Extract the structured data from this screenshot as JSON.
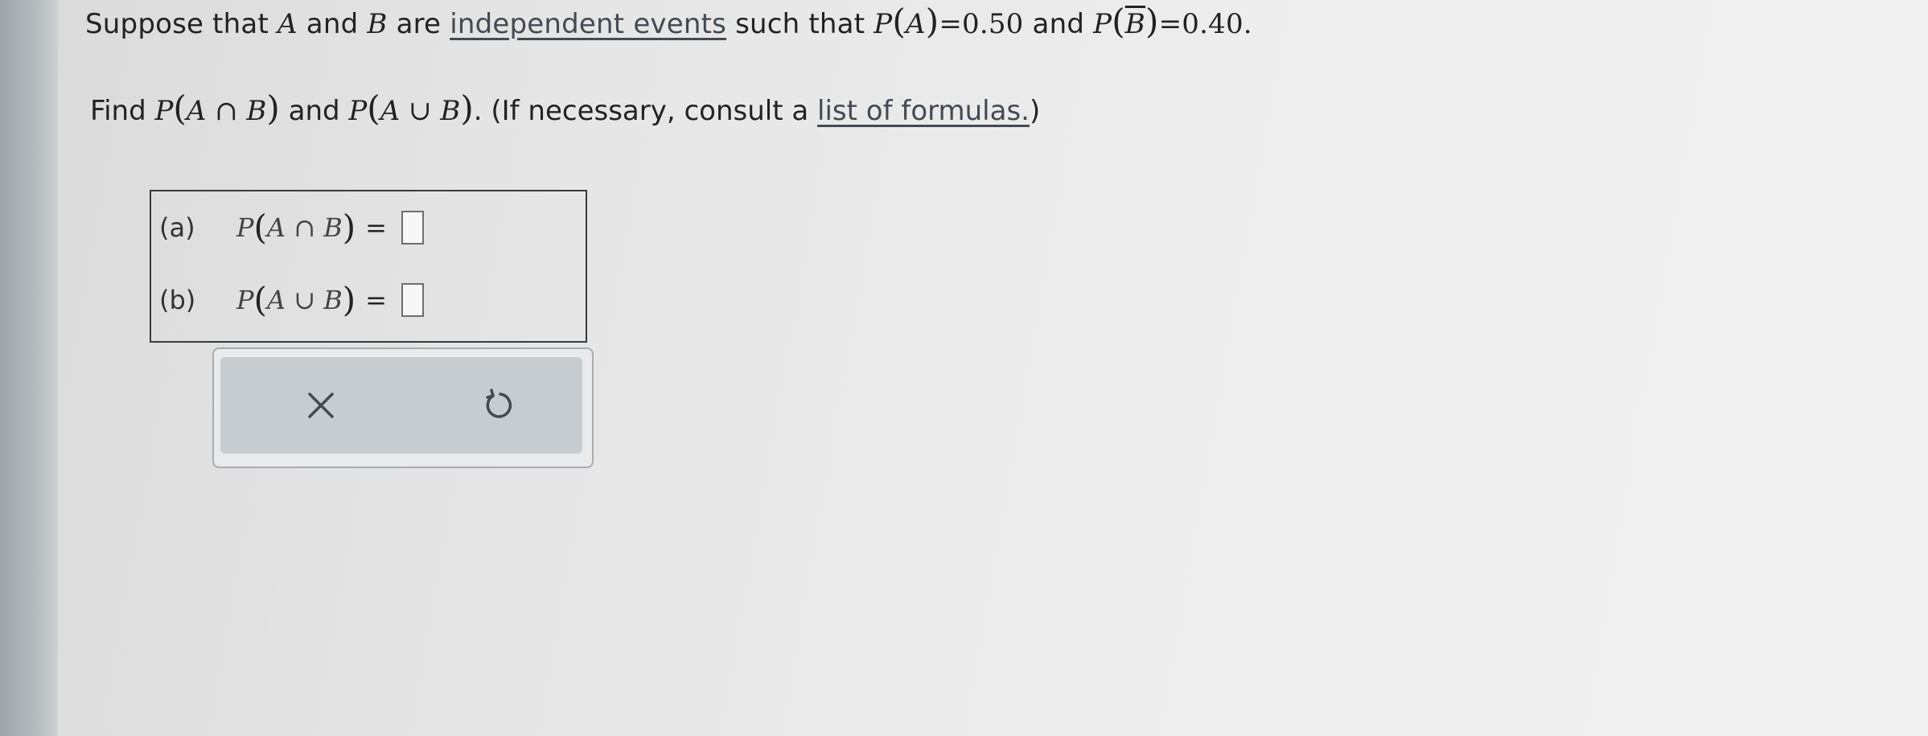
{
  "question": {
    "line1": {
      "prefix": "Suppose that",
      "var_a": "A",
      "and_1": "and",
      "var_b": "B",
      "are": "are",
      "link_text": "independent events",
      "such_that": "such that",
      "pa_expr_p": "P",
      "pa_expr_var": "A",
      "pa_value": "=0.50",
      "and_2": "and",
      "pb_expr_p": "P",
      "pb_expr_var": "B",
      "pb_value": "=0.40."
    },
    "line2": {
      "find": "Find",
      "p1": "P",
      "intersect_expr": "A ∩ B",
      "and": "and",
      "p2": "P",
      "union_expr": "A ∪ B",
      "period": ".",
      "instruction": "(If necessary, consult a",
      "link_text": "list of formulas.",
      "close_paren": ")"
    }
  },
  "answers": {
    "part_a": {
      "label": "(a)",
      "p": "P",
      "expr": "A ∩ B",
      "equals": "="
    },
    "part_b": {
      "label": "(b)",
      "p": "P",
      "expr": "A ∪ B",
      "equals": "="
    }
  },
  "toolbar": {
    "clear_icon": "x-icon",
    "undo_icon": "undo-icon"
  }
}
